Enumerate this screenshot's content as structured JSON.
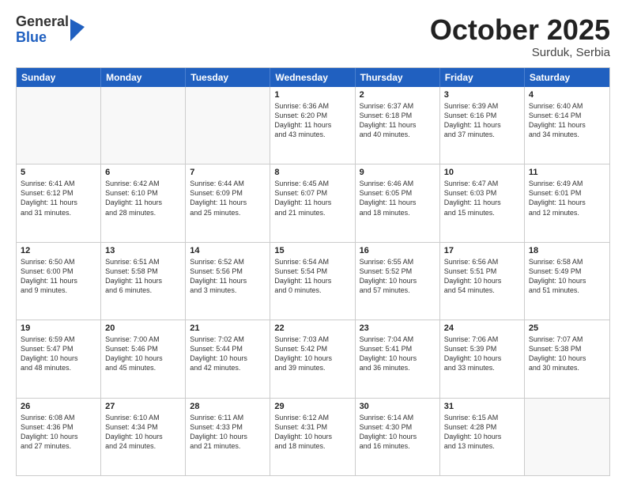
{
  "header": {
    "logo_general": "General",
    "logo_blue": "Blue",
    "month_title": "October 2025",
    "location": "Surduk, Serbia"
  },
  "weekdays": [
    "Sunday",
    "Monday",
    "Tuesday",
    "Wednesday",
    "Thursday",
    "Friday",
    "Saturday"
  ],
  "rows": [
    [
      {
        "day": "",
        "text": "",
        "empty": true
      },
      {
        "day": "",
        "text": "",
        "empty": true
      },
      {
        "day": "",
        "text": "",
        "empty": true
      },
      {
        "day": "1",
        "text": "Sunrise: 6:36 AM\nSunset: 6:20 PM\nDaylight: 11 hours\nand 43 minutes."
      },
      {
        "day": "2",
        "text": "Sunrise: 6:37 AM\nSunset: 6:18 PM\nDaylight: 11 hours\nand 40 minutes."
      },
      {
        "day": "3",
        "text": "Sunrise: 6:39 AM\nSunset: 6:16 PM\nDaylight: 11 hours\nand 37 minutes."
      },
      {
        "day": "4",
        "text": "Sunrise: 6:40 AM\nSunset: 6:14 PM\nDaylight: 11 hours\nand 34 minutes."
      }
    ],
    [
      {
        "day": "5",
        "text": "Sunrise: 6:41 AM\nSunset: 6:12 PM\nDaylight: 11 hours\nand 31 minutes."
      },
      {
        "day": "6",
        "text": "Sunrise: 6:42 AM\nSunset: 6:10 PM\nDaylight: 11 hours\nand 28 minutes."
      },
      {
        "day": "7",
        "text": "Sunrise: 6:44 AM\nSunset: 6:09 PM\nDaylight: 11 hours\nand 25 minutes."
      },
      {
        "day": "8",
        "text": "Sunrise: 6:45 AM\nSunset: 6:07 PM\nDaylight: 11 hours\nand 21 minutes."
      },
      {
        "day": "9",
        "text": "Sunrise: 6:46 AM\nSunset: 6:05 PM\nDaylight: 11 hours\nand 18 minutes."
      },
      {
        "day": "10",
        "text": "Sunrise: 6:47 AM\nSunset: 6:03 PM\nDaylight: 11 hours\nand 15 minutes."
      },
      {
        "day": "11",
        "text": "Sunrise: 6:49 AM\nSunset: 6:01 PM\nDaylight: 11 hours\nand 12 minutes."
      }
    ],
    [
      {
        "day": "12",
        "text": "Sunrise: 6:50 AM\nSunset: 6:00 PM\nDaylight: 11 hours\nand 9 minutes."
      },
      {
        "day": "13",
        "text": "Sunrise: 6:51 AM\nSunset: 5:58 PM\nDaylight: 11 hours\nand 6 minutes."
      },
      {
        "day": "14",
        "text": "Sunrise: 6:52 AM\nSunset: 5:56 PM\nDaylight: 11 hours\nand 3 minutes."
      },
      {
        "day": "15",
        "text": "Sunrise: 6:54 AM\nSunset: 5:54 PM\nDaylight: 11 hours\nand 0 minutes."
      },
      {
        "day": "16",
        "text": "Sunrise: 6:55 AM\nSunset: 5:52 PM\nDaylight: 10 hours\nand 57 minutes."
      },
      {
        "day": "17",
        "text": "Sunrise: 6:56 AM\nSunset: 5:51 PM\nDaylight: 10 hours\nand 54 minutes."
      },
      {
        "day": "18",
        "text": "Sunrise: 6:58 AM\nSunset: 5:49 PM\nDaylight: 10 hours\nand 51 minutes."
      }
    ],
    [
      {
        "day": "19",
        "text": "Sunrise: 6:59 AM\nSunset: 5:47 PM\nDaylight: 10 hours\nand 48 minutes."
      },
      {
        "day": "20",
        "text": "Sunrise: 7:00 AM\nSunset: 5:46 PM\nDaylight: 10 hours\nand 45 minutes."
      },
      {
        "day": "21",
        "text": "Sunrise: 7:02 AM\nSunset: 5:44 PM\nDaylight: 10 hours\nand 42 minutes."
      },
      {
        "day": "22",
        "text": "Sunrise: 7:03 AM\nSunset: 5:42 PM\nDaylight: 10 hours\nand 39 minutes."
      },
      {
        "day": "23",
        "text": "Sunrise: 7:04 AM\nSunset: 5:41 PM\nDaylight: 10 hours\nand 36 minutes."
      },
      {
        "day": "24",
        "text": "Sunrise: 7:06 AM\nSunset: 5:39 PM\nDaylight: 10 hours\nand 33 minutes."
      },
      {
        "day": "25",
        "text": "Sunrise: 7:07 AM\nSunset: 5:38 PM\nDaylight: 10 hours\nand 30 minutes."
      }
    ],
    [
      {
        "day": "26",
        "text": "Sunrise: 6:08 AM\nSunset: 4:36 PM\nDaylight: 10 hours\nand 27 minutes."
      },
      {
        "day": "27",
        "text": "Sunrise: 6:10 AM\nSunset: 4:34 PM\nDaylight: 10 hours\nand 24 minutes."
      },
      {
        "day": "28",
        "text": "Sunrise: 6:11 AM\nSunset: 4:33 PM\nDaylight: 10 hours\nand 21 minutes."
      },
      {
        "day": "29",
        "text": "Sunrise: 6:12 AM\nSunset: 4:31 PM\nDaylight: 10 hours\nand 18 minutes."
      },
      {
        "day": "30",
        "text": "Sunrise: 6:14 AM\nSunset: 4:30 PM\nDaylight: 10 hours\nand 16 minutes."
      },
      {
        "day": "31",
        "text": "Sunrise: 6:15 AM\nSunset: 4:28 PM\nDaylight: 10 hours\nand 13 minutes."
      },
      {
        "day": "",
        "text": "",
        "empty": true
      }
    ]
  ]
}
